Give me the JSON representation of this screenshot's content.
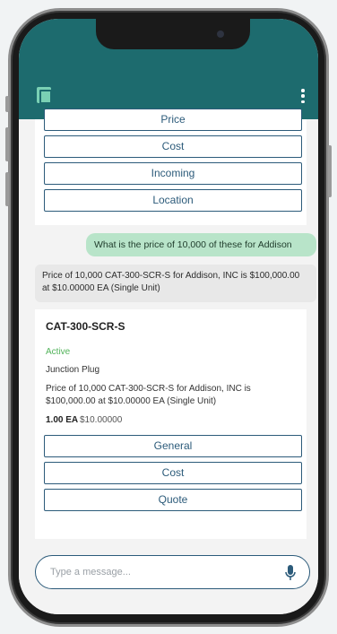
{
  "colors": {
    "app_bar": "#1d6b6e",
    "accent": "#2c5b7a",
    "user_bubble": "#b8e4c9",
    "status_active": "#52b35a"
  },
  "app_bar": {
    "logo_icon": "app-logo-icon",
    "menu_icon": "kebab-menu-icon"
  },
  "prev_card": {
    "buttons": [
      "Price",
      "Cost",
      "Incoming",
      "Location"
    ]
  },
  "messages": {
    "user": "What is the price of 10,000 of these for Addison",
    "bot": "Price of 10,000 CAT-300-SCR-S for Addison, INC is $100,000.00 at $10.00000 EA (Single Unit)"
  },
  "product": {
    "title": "CAT-300-SCR-S",
    "status": "Active",
    "description": "Junction Plug",
    "price_text": "Price of 10,000 CAT-300-SCR-S for Addison, INC is $100,000.00 at $10.00000 EA (Single Unit)",
    "qty": "1.00 EA",
    "unit_price": "$10.00000",
    "buttons": [
      "General",
      "Cost",
      "Quote"
    ]
  },
  "composer": {
    "placeholder": "Type a message...",
    "mic_icon": "microphone-icon"
  }
}
